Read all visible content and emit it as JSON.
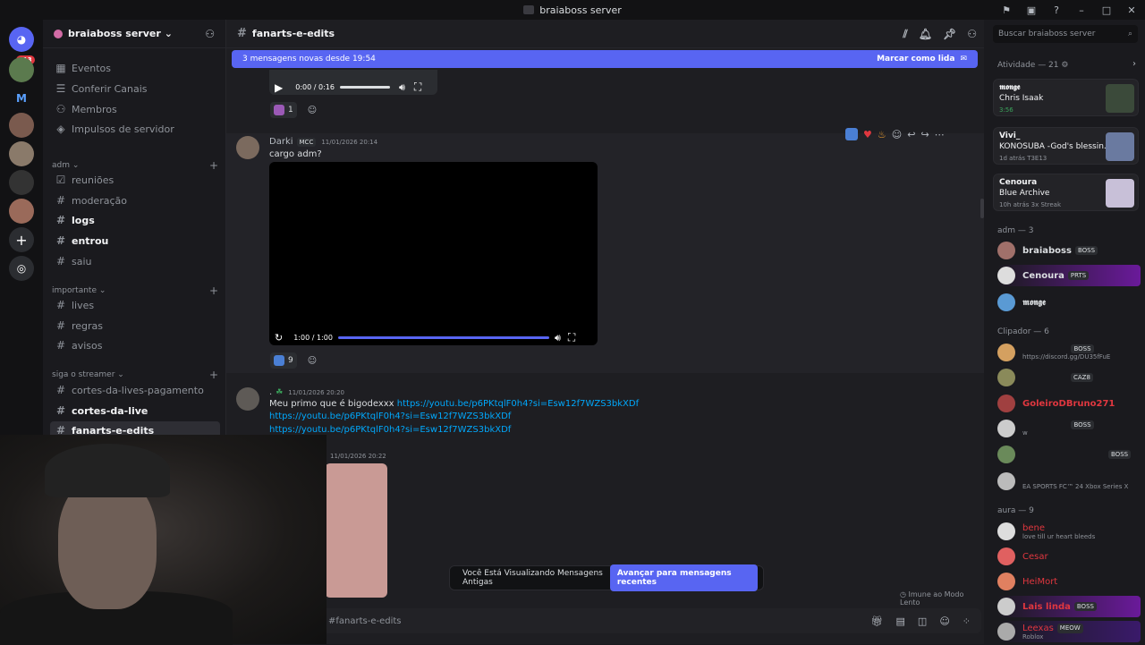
{
  "window": {
    "title": "braiaboss server"
  },
  "guilds": {
    "home_badge": "413"
  },
  "server": {
    "name": "braiaboss server"
  },
  "nav_items": [
    {
      "label": "Eventos"
    },
    {
      "label": "Conferir Canais"
    },
    {
      "label": "Membros"
    },
    {
      "label": "Impulsos de servidor"
    }
  ],
  "categories": {
    "adm": {
      "label": "adm",
      "channels": [
        "reuniões",
        "moderação",
        "logs",
        "entrou",
        "saiu"
      ]
    },
    "importante": {
      "label": "importante",
      "channels": [
        "lives",
        "regras",
        "avisos"
      ]
    },
    "streamer": {
      "label": "siga o streamer",
      "channels": [
        "cortes-da-lives-pagamento",
        "cortes-da-live",
        "fanarts-e-edits"
      ]
    }
  },
  "channel": {
    "name": "fanarts-e-edits"
  },
  "new_messages": {
    "text": "3 mensagens novas desde 19:54",
    "action": "Marcar como lida"
  },
  "search": {
    "placeholder": "Buscar braiaboss server"
  },
  "messages": {
    "audio": {
      "time": "0:00 / 0:16",
      "reaction_count": "1"
    },
    "darki": {
      "author": "Darki",
      "tag": "MCC",
      "timestamp": "11/01/2026 20:14",
      "text": "cargo adm?",
      "video_time": "1:00 / 1:00",
      "video_progress": 1,
      "reaction_count": "9"
    },
    "second": {
      "author": ".",
      "timestamp": "11/01/2026 20:20",
      "text": "Meu primo que é bigodexxx",
      "link": "https://youtu.be/p6PKtqlF0h4?si=Esw12f7WZS3bkXDf"
    },
    "third": {
      "timestamp": "11/01/2026 20:22"
    }
  },
  "activity": {
    "header": "Atividade — 21",
    "cards": [
      {
        "name": "𝖒𝖔𝖓𝖌𝖊",
        "title": "Chris Isaak",
        "sub": "3:56"
      },
      {
        "name": "Vivi_",
        "title": "KONOSUBA -God's blessin...",
        "sub": "1d atrás   T3E13"
      },
      {
        "name": "Cenoura",
        "title": "Blue Archive",
        "sub": "10h atrás   3x Streak"
      }
    ]
  },
  "groups": {
    "adm": {
      "header": "adm — 3",
      "members": [
        {
          "name": "braiaboss",
          "tag": "BOSS",
          "color": "#f2f3f5"
        },
        {
          "name": "Cenoura",
          "tag": "PRTS",
          "color": "#f2f3f5"
        },
        {
          "name": "𝖒𝖔𝖓𝖌𝖊",
          "tag": "",
          "color": "#f2f3f5"
        }
      ]
    },
    "clipador": {
      "header": "Clipador — 6",
      "members": [
        {
          "name": "",
          "tag": "BOSS",
          "status": "https://discord.gg/DU35fFuE"
        },
        {
          "name": "",
          "tag": "CAZ8",
          "status": ""
        },
        {
          "name": "GoleiroDBruno271",
          "tag": "",
          "status": "",
          "color": "#e0373f"
        },
        {
          "name": "",
          "tag": "BOSS",
          "status": "w"
        },
        {
          "name": "",
          "tag": "BOSS",
          "status": ""
        },
        {
          "name": "",
          "tag": "",
          "status": "EA SPORTS FC™ 24 Xbox Series X"
        }
      ]
    },
    "aura": {
      "header": "aura — 9",
      "members": [
        {
          "name": "bene",
          "tag": "",
          "status": "love till ur heart bleeds",
          "color": "#e0373f"
        },
        {
          "name": "Cesar",
          "tag": "",
          "status": "",
          "color": "#e0373f"
        },
        {
          "name": "HeiMort",
          "tag": "",
          "status": "",
          "color": "#e0373f"
        },
        {
          "name": "Lais linda",
          "tag": "BOSS",
          "status": "",
          "color": "#e0373f"
        },
        {
          "name": "Leexas",
          "tag": "MEOW",
          "status": "Roblox",
          "color": "#e0373f"
        }
      ]
    }
  },
  "banner": {
    "text": "Você Está Visualizando Mensagens Antigas",
    "button": "Avançar para mensagens recentes"
  },
  "slowmode": {
    "text": "Imune ao Modo Lento"
  },
  "composer": {
    "placeholder": "#fanarts-e-edits"
  },
  "colors": {
    "accent": "#5865f2",
    "link": "#00a8fc",
    "danger": "#e0373f"
  }
}
